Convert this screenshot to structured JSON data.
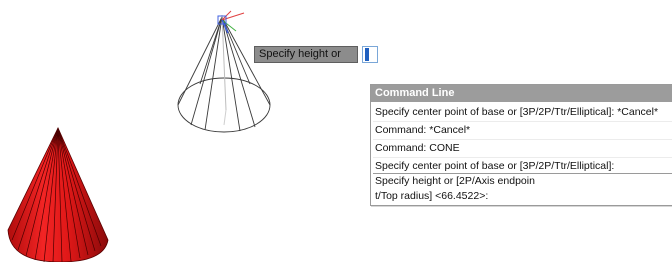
{
  "dynamic_input": {
    "prompt": "Specify height or",
    "value": ""
  },
  "command_line": {
    "title": "Command Line",
    "history": [
      "Specify center point of base or [3P/2P/Ttr/Elliptical]: *Cancel*",
      "Command: *Cancel*",
      "Command: CONE",
      "Specify center point of base or [3P/2P/Ttr/Elliptical]:"
    ],
    "current_prompt": [
      "Specify height or [2P/Axis endpoin",
      "t/Top radius] <66.4522>:"
    ]
  },
  "colors": {
    "cone_fill": "#e11b1b",
    "cone_dark": "#8a0a0a",
    "wireframe": "#3a3a3a",
    "ucs_x": "#e04040",
    "ucs_y": "#40b040",
    "ucs_z": "#4060e0"
  }
}
